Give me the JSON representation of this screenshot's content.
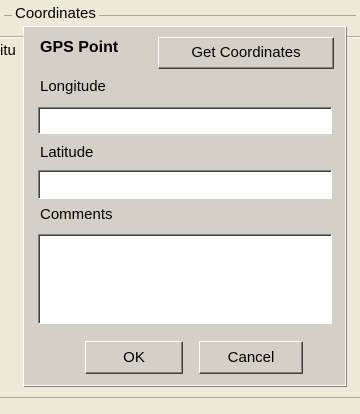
{
  "background": {
    "groupbox_label": "Coordinates",
    "stub_text": "itu"
  },
  "dialog": {
    "title": "GPS Point",
    "get_coordinates_label": "Get Coordinates",
    "fields": {
      "longitude": {
        "label": "Longitude",
        "value": ""
      },
      "latitude": {
        "label": "Latitude",
        "value": ""
      },
      "comments": {
        "label": "Comments",
        "value": ""
      }
    },
    "ok_label": "OK",
    "cancel_label": "Cancel"
  },
  "colors": {
    "dialog_face": "#d4d0c8",
    "window_background": "#ece9d8",
    "field_background": "#ffffff"
  }
}
